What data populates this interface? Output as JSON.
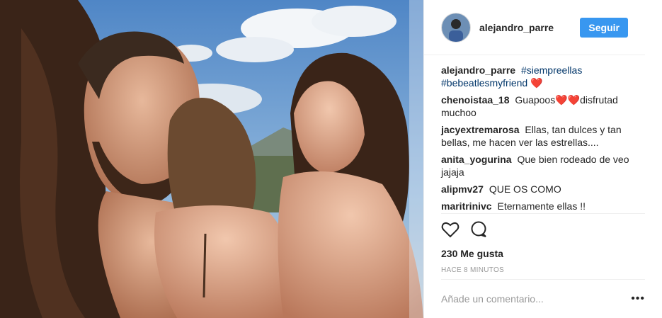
{
  "post": {
    "username": "alejandro_parre",
    "follow_label": "Seguir",
    "comments": [
      {
        "user": "alejandro_parre",
        "parts": [
          "#siempreellas",
          "#bebeatlesmyfriend"
        ],
        "emoji": "❤️"
      },
      {
        "user": "chenoistaa_18",
        "text": "Guapoos",
        "emoji": "❤️❤️",
        "text2": "disfrutad muchoo"
      },
      {
        "user": "jacyextremarosa",
        "text": "Ellas, tan dulces y tan bellas, me hacen ver las estrellas...."
      },
      {
        "user": "anita_yogurina",
        "text": "Que bien rodeado de veo jajaja"
      },
      {
        "user": "alipmv27",
        "text": "QUE OS COMO"
      },
      {
        "user": "maritrinivc",
        "text": "Eternamente ellas !!"
      }
    ],
    "likes": "230 Me gusta",
    "time": "HACE 8 MINUTOS",
    "add_comment_placeholder": "Añade un comentario...",
    "more_label": "•••"
  },
  "colors": {
    "accent": "#3897f0",
    "heart": "#ed4956",
    "hashtag": "#003569"
  },
  "icons": [
    "like-heart-icon",
    "comment-bubble-icon",
    "more-options-icon"
  ]
}
